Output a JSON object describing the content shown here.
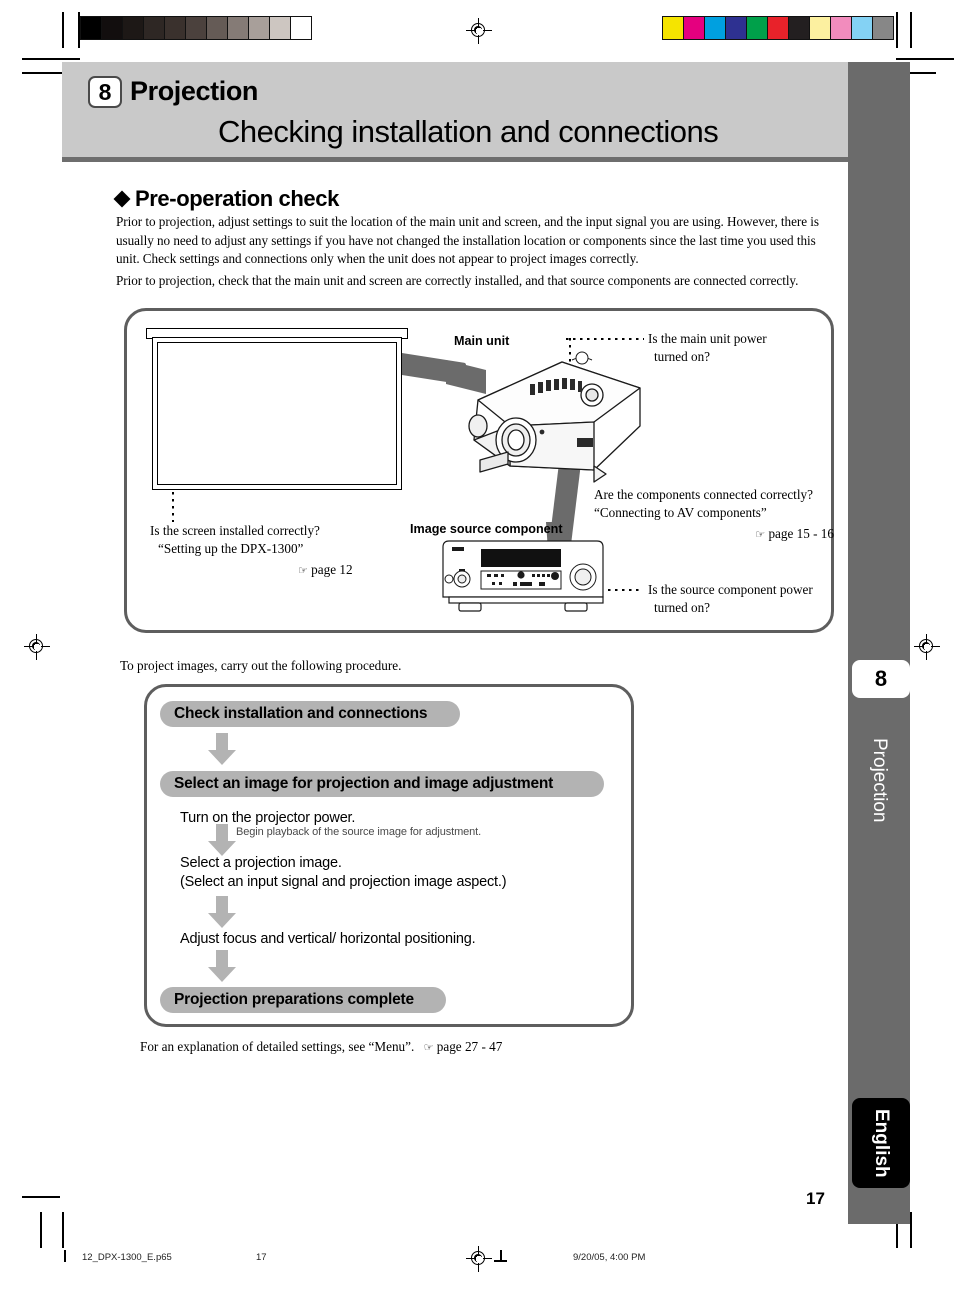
{
  "header": {
    "chapter_number": "8",
    "chapter_title": "Projection",
    "page_title": "Checking installation and connections"
  },
  "section": {
    "heading": "Pre-operation check",
    "intro_paragraph_1": "Prior to projection, adjust settings to suit the location of the main unit and screen, and the input signal you are using. However, there is usually no need to adjust any settings if you have not changed the installation location or components since the last time you used this unit. Check settings and connections only when the unit does not appear to project images correctly.",
    "intro_paragraph_2": "Prior to projection, check that the main unit and screen are correctly installed, and that source components are connected correctly."
  },
  "diagram": {
    "main_unit_label": "Main unit",
    "image_source_label": "Image source component",
    "callout_power_line1": "Is the main unit power",
    "callout_power_line2": "turned on?",
    "callout_components_line1": "Are the components connected correctly?",
    "callout_components_line2": "“Connecting to AV components”",
    "callout_components_pageref": "page 15 - 16",
    "callout_source_power_line1": "Is the source component power",
    "callout_source_power_line2": "turned on?",
    "callout_screen_line1": "Is the screen installed correctly?",
    "callout_screen_line2": "“Setting up the DPX-1300”",
    "callout_screen_pageref": "page 12",
    "hand_icon": "☞"
  },
  "flow": {
    "intro": "To project images, carry out the following procedure.",
    "step_1": "Check installation and connections",
    "step_2": "Select an image for projection and image adjustment",
    "step_3": "Turn on the projector power.",
    "step_3_note": "Begin playback of the source image for adjustment.",
    "step_4_line1": "Select a projection image.",
    "step_4_line2": "(Select an input signal and projection image aspect.)",
    "step_5": "Adjust focus and vertical/ horizontal positioning.",
    "step_6": "Projection preparations complete",
    "footer_note": "For an explanation of detailed settings, see “Menu”.",
    "footer_pageref": "page 27 - 47",
    "hand_icon": "☞"
  },
  "sidebar": {
    "chapter_number": "8",
    "chapter_label": "Projection",
    "language_label": "English",
    "page_number": "17"
  },
  "footer": {
    "filename": "12_DPX-1300_E.p65",
    "page": "17",
    "timestamp": "9/20/05, 4:00 PM"
  },
  "colors": {
    "header_band": "#c9c9c9",
    "header_rule": "#6e6e6e",
    "panel_border": "#5e5e5e",
    "pill_fill": "#b3b3b3",
    "band_gray": "#6b6b6b",
    "side_strip": "#6b6b6b",
    "lang_tab": "#000000"
  },
  "calibration": {
    "grayscale_swatches": [
      "#000000",
      "#120e0e",
      "#1d1816",
      "#2e2724",
      "#3a312d",
      "#4b413d",
      "#655b56",
      "#857b76",
      "#a89f9a",
      "#cdc6c1",
      "#ffffff"
    ],
    "color_swatches": [
      "#f5e400",
      "#e5007f",
      "#00a0e0",
      "#2e3191",
      "#00a04a",
      "#e8222a",
      "#231f20",
      "#fcf0a0",
      "#f28cbd",
      "#84d2f4",
      "#878787"
    ]
  }
}
